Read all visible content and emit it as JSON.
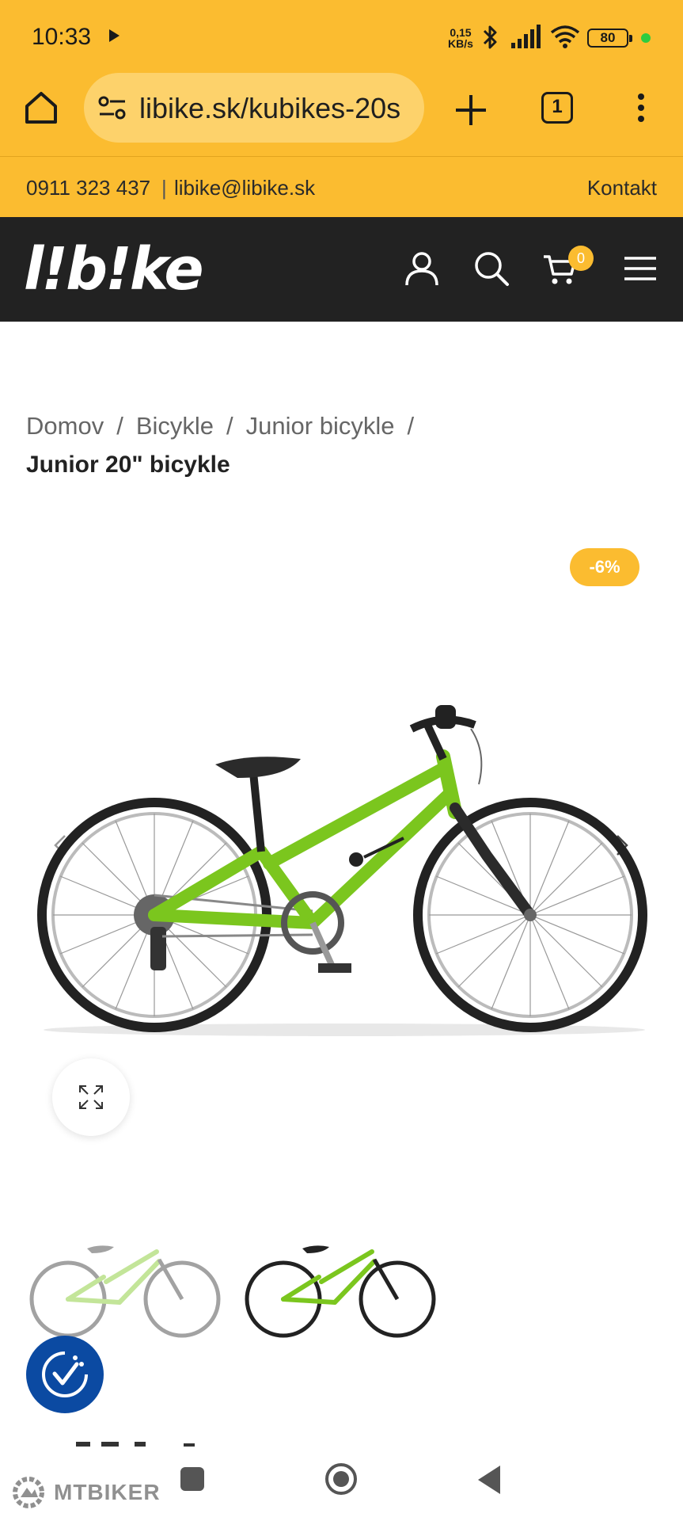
{
  "status_bar": {
    "time": "10:33",
    "net_speed_value": "0,15",
    "net_speed_unit": "KB/s",
    "battery": "80",
    "icons": [
      "play-icon",
      "bluetooth-icon",
      "signal-icon",
      "wifi-icon",
      "battery-icon"
    ]
  },
  "browser": {
    "url": "libike.sk/kubikes-20s",
    "tab_count": "1"
  },
  "contact": {
    "phone": "0911 323 437",
    "separator": "|",
    "email": "libike@libike.sk",
    "contact_link": "Kontakt"
  },
  "header": {
    "logo_text": "l!b!ke",
    "cart_count": "0"
  },
  "breadcrumb": {
    "items": [
      "Domov",
      "Bicykle",
      "Junior bicykle"
    ],
    "separator": "/",
    "current": "Junior 20\" bicykle"
  },
  "product": {
    "discount_badge": "-6%"
  },
  "watermark": {
    "text": "MTBIKER"
  },
  "colors": {
    "accent": "#FBBC30",
    "header_bg": "#222222",
    "bike_green": "#7BC61E",
    "a11y_blue": "#0b4aa2"
  }
}
